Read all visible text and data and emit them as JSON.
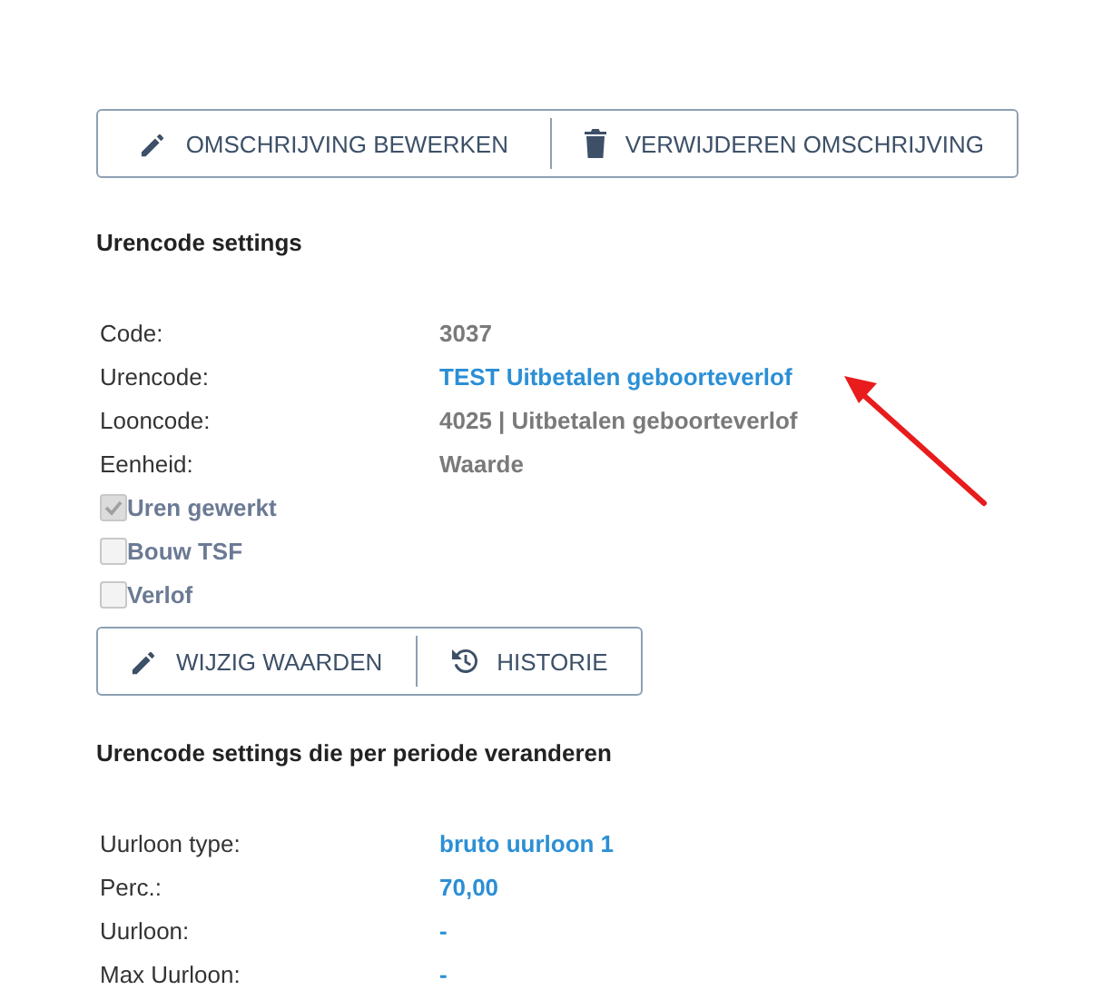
{
  "top_buttons": [
    {
      "label": "OMSCHRIJVING BEWERKEN"
    },
    {
      "label": "VERWIJDEREN OMSCHRIJVING"
    }
  ],
  "settings": {
    "title": "Urencode settings",
    "fields": [
      {
        "label": "Code:",
        "value": "3037",
        "kind": "text"
      },
      {
        "label": "Urencode:",
        "value": "TEST Uitbetalen geboorteverlof",
        "kind": "link"
      },
      {
        "label": "Looncode:",
        "value": "4025 | Uitbetalen geboorteverlof",
        "kind": "text"
      },
      {
        "label": "Eenheid:",
        "value": "Waarde",
        "kind": "text"
      }
    ],
    "checkboxes": [
      {
        "label": "Uren gewerkt",
        "checked": true,
        "disabled": true
      },
      {
        "label": "Bouw TSF",
        "checked": false,
        "disabled": true
      },
      {
        "label": "Verlof",
        "checked": false,
        "disabled": true
      }
    ],
    "buttons": [
      {
        "label": "WIJZIG WAARDEN"
      },
      {
        "label": "HISTORIE"
      }
    ]
  },
  "period_settings": {
    "title": "Urencode settings die per periode veranderen",
    "fields": [
      {
        "label": "Uurloon type:",
        "value": "bruto uurloon 1",
        "kind": "link"
      },
      {
        "label": "Perc.:",
        "value": "70,00",
        "kind": "link"
      },
      {
        "label": "Uurloon:",
        "value": "-",
        "kind": "link"
      },
      {
        "label": "Max Uurloon:",
        "value": "-",
        "kind": "link"
      }
    ]
  }
}
